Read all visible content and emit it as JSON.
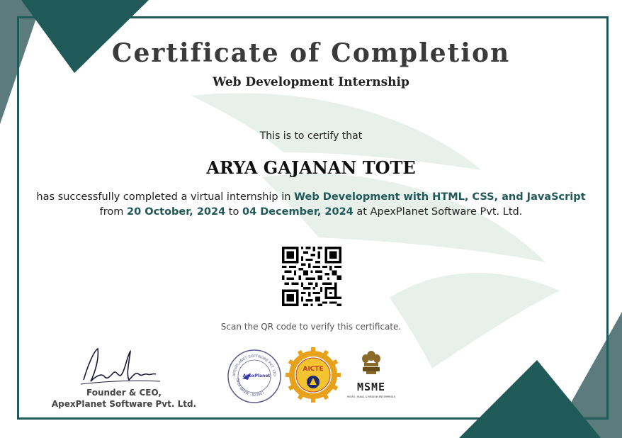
{
  "certificate": {
    "title": "Certificate of Completion",
    "subtitle": "Web Development Internship",
    "certify_line": "This is to certify that",
    "recipient_name": "ARYA GAJANAN TOTE",
    "body_line1_prefix": "has successfully completed a virtual internship in ",
    "program": "Web Development with HTML, CSS, and JavaScript",
    "body_line2_from": "from ",
    "start_date": "20 October, 2024",
    "body_line2_to": " to ",
    "end_date": "04 December, 2024",
    "body_line2_suffix": " at ApexPlanet Software Pvt. Ltd.",
    "qr_caption": "Scan the QR code to verify this certificate.",
    "signatory_title": "Founder & CEO,",
    "signatory_company": "ApexPlanet Software Pvt. Ltd."
  },
  "logos": {
    "apexplanet": {
      "ring_top": "APEXPLANET SOFTWARE PVT. LTD.",
      "center": "ApexPlanet",
      "ring_bottom": "GAYA BIHAR - 823001"
    },
    "aicte": {
      "label": "AICTE"
    },
    "msme": {
      "label": "MSME",
      "sub": "MICRO, SMALL & MEDIUM ENTERPRISES"
    }
  },
  "colors": {
    "accent": "#1f5a58",
    "corner_light": "#5b7b7c",
    "watermark": "#e8f0ec"
  }
}
